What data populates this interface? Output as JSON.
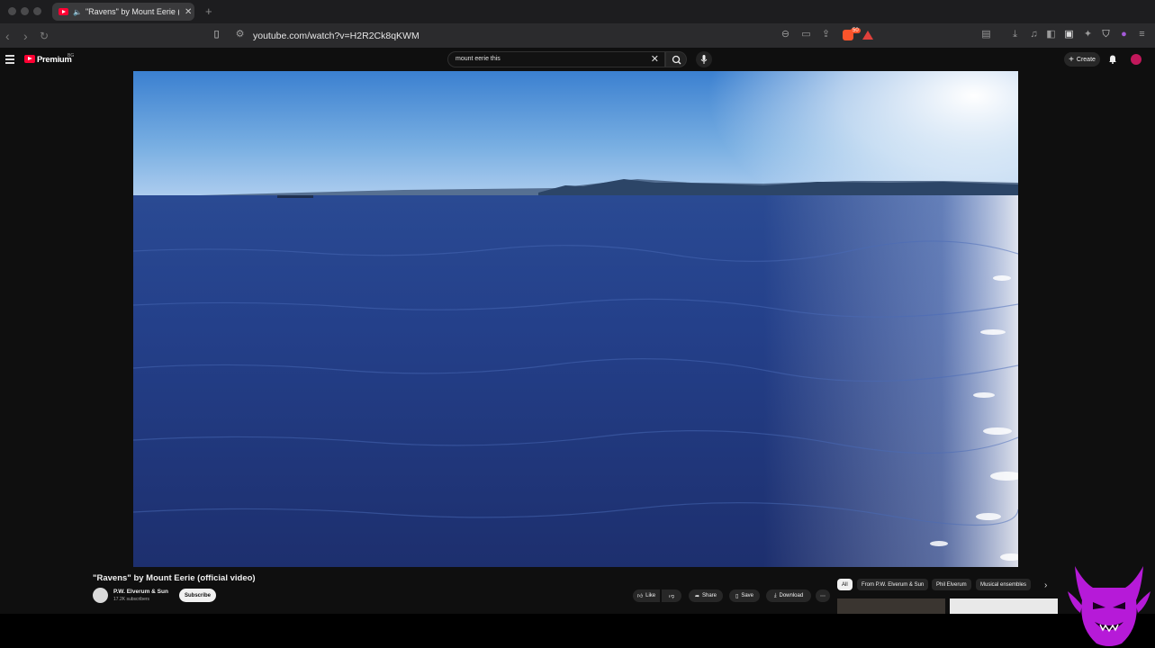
{
  "browser": {
    "tab_title": "\"Ravens\" by Mount Eerie (o",
    "url": "youtube.com/watch?v=H2R2Ck8qKWM",
    "brave_badge": "50"
  },
  "youtube": {
    "brand": "Premium",
    "brand_sup": "BG",
    "search_value": "mount eerie this",
    "create_label": "Create"
  },
  "video": {
    "title": "\"Ravens\" by Mount Eerie (official video)",
    "channel": "P.W. Elverum & Sun",
    "subscribers": "17.2K subscribers",
    "subscribe_label": "Subscribe",
    "actions": {
      "like": "Like",
      "share": "Share",
      "save": "Save",
      "download": "Download"
    }
  },
  "chips": [
    "All",
    "From P.W. Elverum & Sun",
    "Phil Elverum",
    "Musical ensembles"
  ],
  "colors": {
    "youtube_red": "#ff0033",
    "background": "#0f0f0f",
    "overlay_devil": "#b61ad8"
  }
}
